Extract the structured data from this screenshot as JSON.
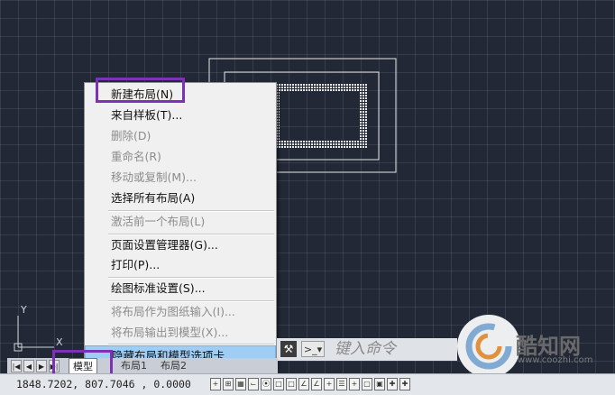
{
  "context_menu": {
    "items": [
      {
        "label": "新建布局(N)",
        "enabled": true
      },
      {
        "label": "来自样板(T)...",
        "enabled": true
      },
      {
        "label": "删除(D)",
        "enabled": false
      },
      {
        "label": "重命名(R)",
        "enabled": false
      },
      {
        "label": "移动或复制(M)...",
        "enabled": false
      },
      {
        "label": "选择所有布局(A)",
        "enabled": true
      },
      {
        "label": "激活前一个布局(L)",
        "enabled": false
      },
      {
        "label": "页面设置管理器(G)...",
        "enabled": true
      },
      {
        "label": "打印(P)...",
        "enabled": true
      },
      {
        "label": "绘图标准设置(S)...",
        "enabled": true
      },
      {
        "label": "将布局作为图纸输入(I)...",
        "enabled": false
      },
      {
        "label": "将布局输出到模型(X)...",
        "enabled": false
      },
      {
        "label": "隐藏布局和模型选项卡",
        "enabled": true,
        "highlighted": true
      }
    ]
  },
  "command_line": {
    "placeholder": "键入命令"
  },
  "layout_tabs": [
    {
      "label": "模型",
      "active": true
    },
    {
      "label": "布局1",
      "active": false
    },
    {
      "label": "布局2",
      "active": false
    }
  ],
  "ucs": {
    "x_label": "X",
    "y_label": "Y"
  },
  "status_bar": {
    "coordinates": "1848.7202, 807.7046 , 0.0000"
  },
  "watermark": {
    "brand": "酷知网",
    "url": "www.coozhi.com"
  },
  "colors": {
    "highlight": "#7b32b5",
    "menu_hover": "#9fcdf3",
    "canvas": "#222836"
  }
}
